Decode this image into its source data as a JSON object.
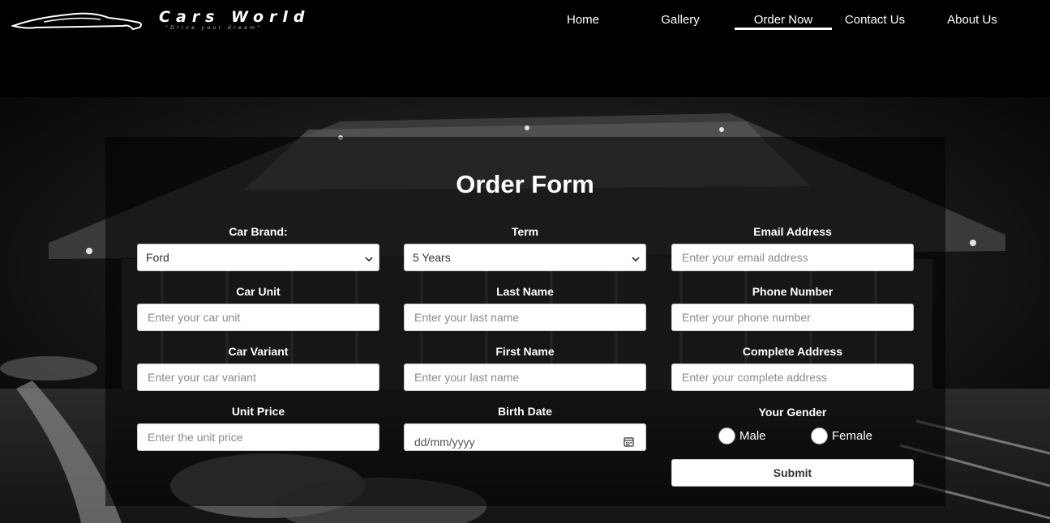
{
  "brand": {
    "title": "Cars World",
    "tagline": "\"Drive your dream\""
  },
  "nav": {
    "items": [
      {
        "label": "Home"
      },
      {
        "label": "Gallery"
      },
      {
        "label": "Order Now",
        "active": true
      },
      {
        "label": "Contact Us"
      },
      {
        "label": "About Us"
      }
    ]
  },
  "form": {
    "title": "Order Form",
    "car_brand": {
      "label": "Car Brand:",
      "value": "Ford"
    },
    "term": {
      "label": "Term",
      "value": "5 Years"
    },
    "email": {
      "label": "Email Address",
      "placeholder": "Enter your email address"
    },
    "car_unit": {
      "label": "Car Unit",
      "placeholder": "Enter your car unit"
    },
    "last_name": {
      "label": "Last Name",
      "placeholder": "Enter your last name"
    },
    "phone": {
      "label": "Phone Number",
      "placeholder": "Enter your phone number"
    },
    "car_variant": {
      "label": "Car Variant",
      "placeholder": "Enter your car variant"
    },
    "first_name": {
      "label": "First Name",
      "placeholder": "Enter your last name"
    },
    "address": {
      "label": "Complete Address",
      "placeholder": "Enter your complete address"
    },
    "unit_price": {
      "label": "Unit Price",
      "placeholder": "Enter the unit price"
    },
    "birth_date": {
      "label": "Birth Date",
      "format": "dd/mm/yyyy"
    },
    "gender": {
      "label": "Your Gender",
      "options": [
        "Male",
        "Female"
      ]
    },
    "submit_label": "Submit"
  },
  "icons": {
    "select_chevron": "chevron-down-icon",
    "calendar": "calendar-icon"
  },
  "colors": {
    "background": "#000000",
    "text": "#ffffff",
    "control_bg": "#ffffff"
  }
}
